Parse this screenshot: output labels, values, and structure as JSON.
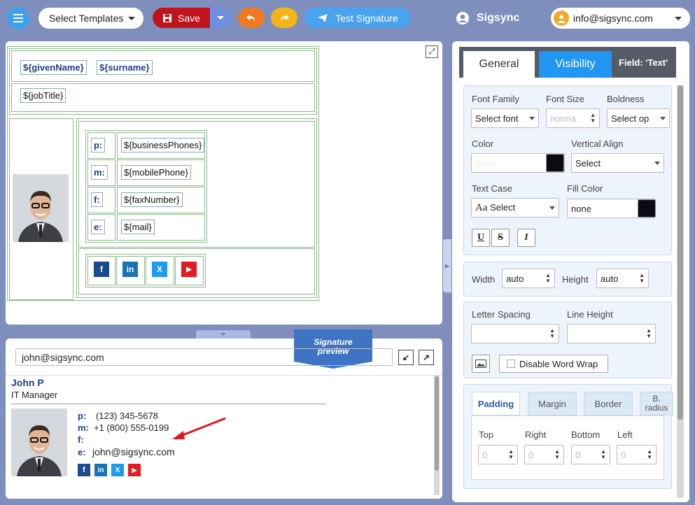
{
  "toolbar": {
    "templates_label": "Select Templates",
    "save_label": "Save",
    "test_label": "Test Signature",
    "brand": "Sigsync",
    "account_email": "info@sigsync.com"
  },
  "editor": {
    "given_name": "${givenName}",
    "surname": "${surname}",
    "job_title": "${jobTitle}",
    "rows": [
      {
        "label": "p:",
        "token": "${businessPhones}"
      },
      {
        "label": "m:",
        "token": "${mobilePhone}"
      },
      {
        "label": "f:",
        "token": "${faxNumber}"
      },
      {
        "label": "e:",
        "token": "${mail}"
      }
    ],
    "social": [
      "f",
      "in",
      "X",
      "▶"
    ]
  },
  "preview": {
    "ribbon_line1": "Signature",
    "ribbon_line2": "preview",
    "email_value": "john@sigsync.com",
    "name": "John P",
    "title": "IT Manager",
    "rows": [
      {
        "label": "p:",
        "value": "(123) 345-5678"
      },
      {
        "label": "m:",
        "value": "+1 (800) 555-0199"
      },
      {
        "label": "f:",
        "value": ""
      },
      {
        "label": "e:",
        "value": "john@sigsync.com"
      }
    ]
  },
  "props": {
    "tab_general": "General",
    "tab_visibility": "Visibility",
    "field_prefix": "Field: ",
    "field_name": "'Text'",
    "font_family_label": "Font Family",
    "font_family_value": "Select font",
    "font_size_label": "Font Size",
    "font_size_placeholder": "norma",
    "boldness_label": "Boldness",
    "boldness_value": "Select op",
    "color_label": "Color",
    "color_placeholder": "black",
    "valign_label": "Vertical Align",
    "valign_value": "Select",
    "text_case_label": "Text Case",
    "text_case_prefix": "Aa",
    "text_case_value": "Select",
    "fill_color_label": "Fill Color",
    "fill_color_value": "none",
    "underline": "U",
    "strike": "S",
    "italic": "I",
    "width_label": "Width",
    "width_value": "auto",
    "height_label": "Height",
    "height_value": "auto",
    "letter_spacing_label": "Letter Spacing",
    "line_height_label": "Line Height",
    "disable_wrap_label": "Disable Word Wrap",
    "subtabs": [
      "Padding",
      "Margin",
      "Border",
      "B.\nradius"
    ],
    "pad_top_label": "Top",
    "pad_right_label": "Right",
    "pad_bottom_label": "Bottom",
    "pad_left_label": "Left",
    "pad_value": "0",
    "swatch_color": "#0b0b12"
  },
  "colors": {
    "accent": "#2196f3",
    "save": "#c0141c",
    "link_blue": "#1f3f8a",
    "arrow": "#e0191b"
  }
}
